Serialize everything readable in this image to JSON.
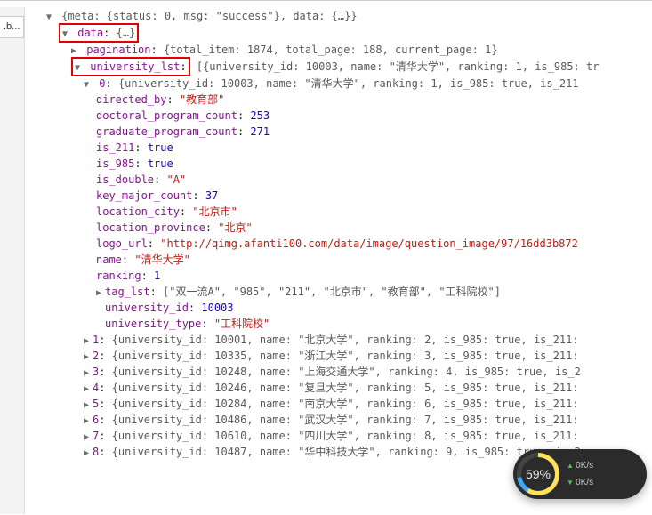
{
  "sidebar": {
    "tab_label": ".b..."
  },
  "root": {
    "preview": "{meta: {status: 0, msg: \"success\"}, data: {…}}",
    "data_key": "data",
    "data_preview": "{…}",
    "pagination_key": "pagination",
    "pagination_preview": "{total_item: 1874, total_page: 188, current_page: 1}",
    "ulst_key": "university_lst",
    "ulst_preview": "[{university_id: 10003, name: \"清华大学\", ranking: 1, is_985: tr",
    "item0_key": "0",
    "item0_preview": "{university_id: 10003, name: \"清华大学\", ranking: 1, is_985: true, is_211",
    "fields": {
      "directed_by": {
        "k": "directed_by",
        "v": "\"教育部\""
      },
      "doctoral": {
        "k": "doctoral_program_count",
        "v": "253"
      },
      "graduate": {
        "k": "graduate_program_count",
        "v": "271"
      },
      "is211": {
        "k": "is_211",
        "v": "true"
      },
      "is985": {
        "k": "is_985",
        "v": "true"
      },
      "isdouble": {
        "k": "is_double",
        "v": "\"A\""
      },
      "keymajor": {
        "k": "key_major_count",
        "v": "37"
      },
      "loccity": {
        "k": "location_city",
        "v": "\"北京市\""
      },
      "locprov": {
        "k": "location_province",
        "v": "\"北京\""
      },
      "logo": {
        "k": "logo_url",
        "v": "\"http://qimg.afanti100.com/data/image/question_image/97/16dd3b872"
      },
      "name": {
        "k": "name",
        "v": "\"清华大学\""
      },
      "ranking": {
        "k": "ranking",
        "v": "1"
      },
      "taglst": {
        "k": "tag_lst",
        "v": "[\"双一流A\", \"985\", \"211\", \"北京市\", \"教育部\", \"工科院校\"]"
      },
      "uid": {
        "k": "university_id",
        "v": "10003"
      },
      "utype": {
        "k": "university_type",
        "v": "\"工科院校\""
      }
    },
    "rest": [
      {
        "k": "1",
        "p": "{university_id: 10001, name: \"北京大学\", ranking: 2, is_985: true, is_211:"
      },
      {
        "k": "2",
        "p": "{university_id: 10335, name: \"浙江大学\", ranking: 3, is_985: true, is_211:"
      },
      {
        "k": "3",
        "p": "{university_id: 10248, name: \"上海交通大学\", ranking: 4, is_985: true, is_2"
      },
      {
        "k": "4",
        "p": "{university_id: 10246, name: \"复旦大学\", ranking: 5, is_985: true, is_211:"
      },
      {
        "k": "5",
        "p": "{university_id: 10284, name: \"南京大学\", ranking: 6, is_985: true, is_211:"
      },
      {
        "k": "6",
        "p": "{university_id: 10486, name: \"武汉大学\", ranking: 7, is_985: true, is_211:"
      },
      {
        "k": "7",
        "p": "{university_id: 10610, name: \"四川大学\", ranking: 8, is_985: true, is_211:"
      },
      {
        "k": "8",
        "p": "{university_id: 10487, name: \"华中科技大学\", ranking: 9, is_985: true, is_2"
      }
    ]
  },
  "widget": {
    "pct": "59%",
    "up": "0K/s",
    "dn": "0K/s"
  }
}
